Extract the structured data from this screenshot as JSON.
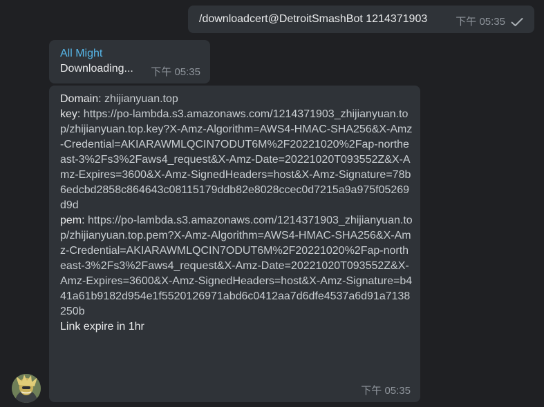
{
  "outgoing": {
    "command": "/downloadcert@DetroitSmashBot",
    "argument": "1214371903",
    "time": "下午 05:35"
  },
  "incoming_status": {
    "sender": "All Might",
    "text": "Downloading...",
    "time": "下午 05:35"
  },
  "incoming_result": {
    "domain_label": "Domain:",
    "domain_value": "zhijianyuan.top",
    "key_label": "key:",
    "key_url": "https://po-lambda.s3.amazonaws.com/1214371903_zhijianyuan.top/zhijianyuan.top.key?X-Amz-Algorithm=AWS4-HMAC-SHA256&X-Amz-Credential=AKIARAWMLQCIN7ODUT6M%2F20221020%2Fap-northeast-3%2Fs3%2Faws4_request&X-Amz-Date=20221020T093552Z&X-Amz-Expires=3600&X-Amz-SignedHeaders=host&X-Amz-Signature=78b6edcbd2858c864643c08115179ddb82e8028ccec0d7215a9a975f05269d9d",
    "pem_label": "pem:",
    "pem_url": "https://po-lambda.s3.amazonaws.com/1214371903_zhijianyuan.top/zhijianyuan.top.pem?X-Amz-Algorithm=AWS4-HMAC-SHA256&X-Amz-Credential=AKIARAWMLQCIN7ODUT6M%2F20221020%2Fap-northeast-3%2Fs3%2Faws4_request&X-Amz-Date=20221020T093552Z&X-Amz-Expires=3600&X-Amz-SignedHeaders=host&X-Amz-Signature=b441a61b9182d954e1f5520126971abd6c0412aa7d6dfe4537a6d91a7138250b",
    "footer": "Link expire in 1hr",
    "time": "下午 05:35"
  },
  "colors": {
    "background": "#1f2023",
    "bubble": "#2f3338",
    "text": "#e9eaeb",
    "sender": "#56b6e8",
    "meta": "#8f959c",
    "link": "#c8cdd1"
  },
  "icons": {
    "sent_check": "check-icon",
    "avatar": "avatar"
  }
}
